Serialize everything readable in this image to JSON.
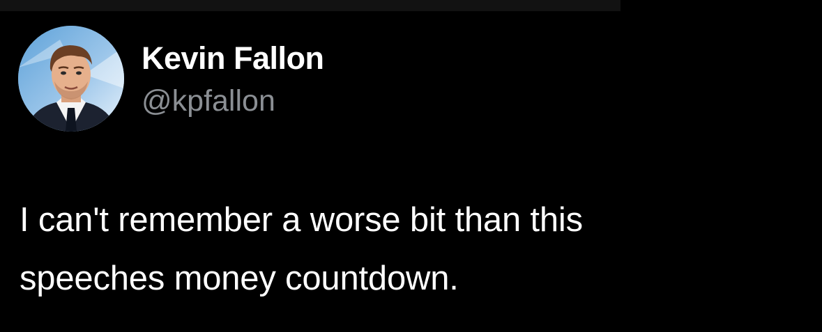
{
  "tweet": {
    "author": {
      "display_name": "Kevin Fallon",
      "handle": "@kpfallon",
      "avatar_icon": "profile-avatar"
    },
    "text_lines": [
      "I can't remember a worse bit than this",
      "speeches money countdown."
    ]
  },
  "colors": {
    "background": "#000000",
    "primary_text": "#ffffff",
    "secondary_text": "#8b8f94"
  }
}
